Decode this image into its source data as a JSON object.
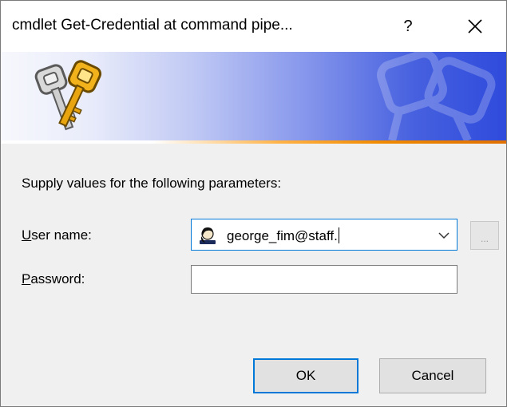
{
  "window": {
    "title": "cmdlet Get-Credential at command pipe...",
    "help_label": "?",
    "close_icon": "close-icon"
  },
  "banner": {
    "icon": "keys-icon"
  },
  "form": {
    "prompt": "Supply values for the following parameters:",
    "username_label_access": "U",
    "username_label_rest": "ser name:",
    "username_value": "george_fim@staff.",
    "username_icon": "user-icon",
    "dropdown_icon": "chevron-down-icon",
    "browse_label": "...",
    "password_label_access": "P",
    "password_label_rest": "assword:",
    "password_value": ""
  },
  "buttons": {
    "ok_label": "OK",
    "cancel_label": "Cancel"
  },
  "colors": {
    "accent": "#0078d7",
    "banner_dark": "#2f4bdc",
    "banner_orange": "#f08a00"
  }
}
